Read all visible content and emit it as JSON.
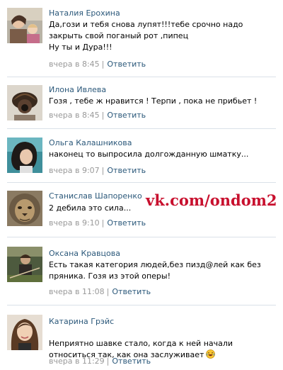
{
  "comments": [
    {
      "author": "Наталия Ерохина",
      "text": "Да,гози и тебя снова лупят!!!тебе срочно надо\nзакрыть свой поганый рот ,пипец\nНу ты и Дура!!!",
      "time": "вчера в 8:45",
      "reply_label": "Ответить"
    },
    {
      "author": "Илона Ивлева",
      "text": "Гозя , тебе ж нравится ! Терпи , пока не прибьет !",
      "time": "вчера в 8:45",
      "reply_label": "Ответить"
    },
    {
      "author": "Ольга Калашникова",
      "text": "наконец то выпросила долгожданную шматку...",
      "time": "вчера в 9:07",
      "reply_label": "Ответить"
    },
    {
      "author": "Станислав Шапоренко",
      "text": "2 дебила это сила...",
      "time": "вчера в 9:10",
      "reply_label": "Ответить"
    },
    {
      "author": "Оксана Кравцова",
      "text": "Есть такая категория людей,без пизд@лей как без\nпряника. Гозя из этой оперы!",
      "time": "вчера в 11:08",
      "reply_label": "Ответить"
    },
    {
      "author": "Катарина Грэйс",
      "text": "Неприятно шавке стало, когда к ней начали\nотноситься так, как она заслуживает",
      "time": "вчера в 11:29",
      "reply_label": "Ответить"
    }
  ],
  "separator": "|",
  "watermark": "vk.com/ondom2",
  "colors": {
    "link": "#2b587a",
    "meta": "#999999",
    "divider": "#dae1e8",
    "watermark": "#c8102e"
  }
}
